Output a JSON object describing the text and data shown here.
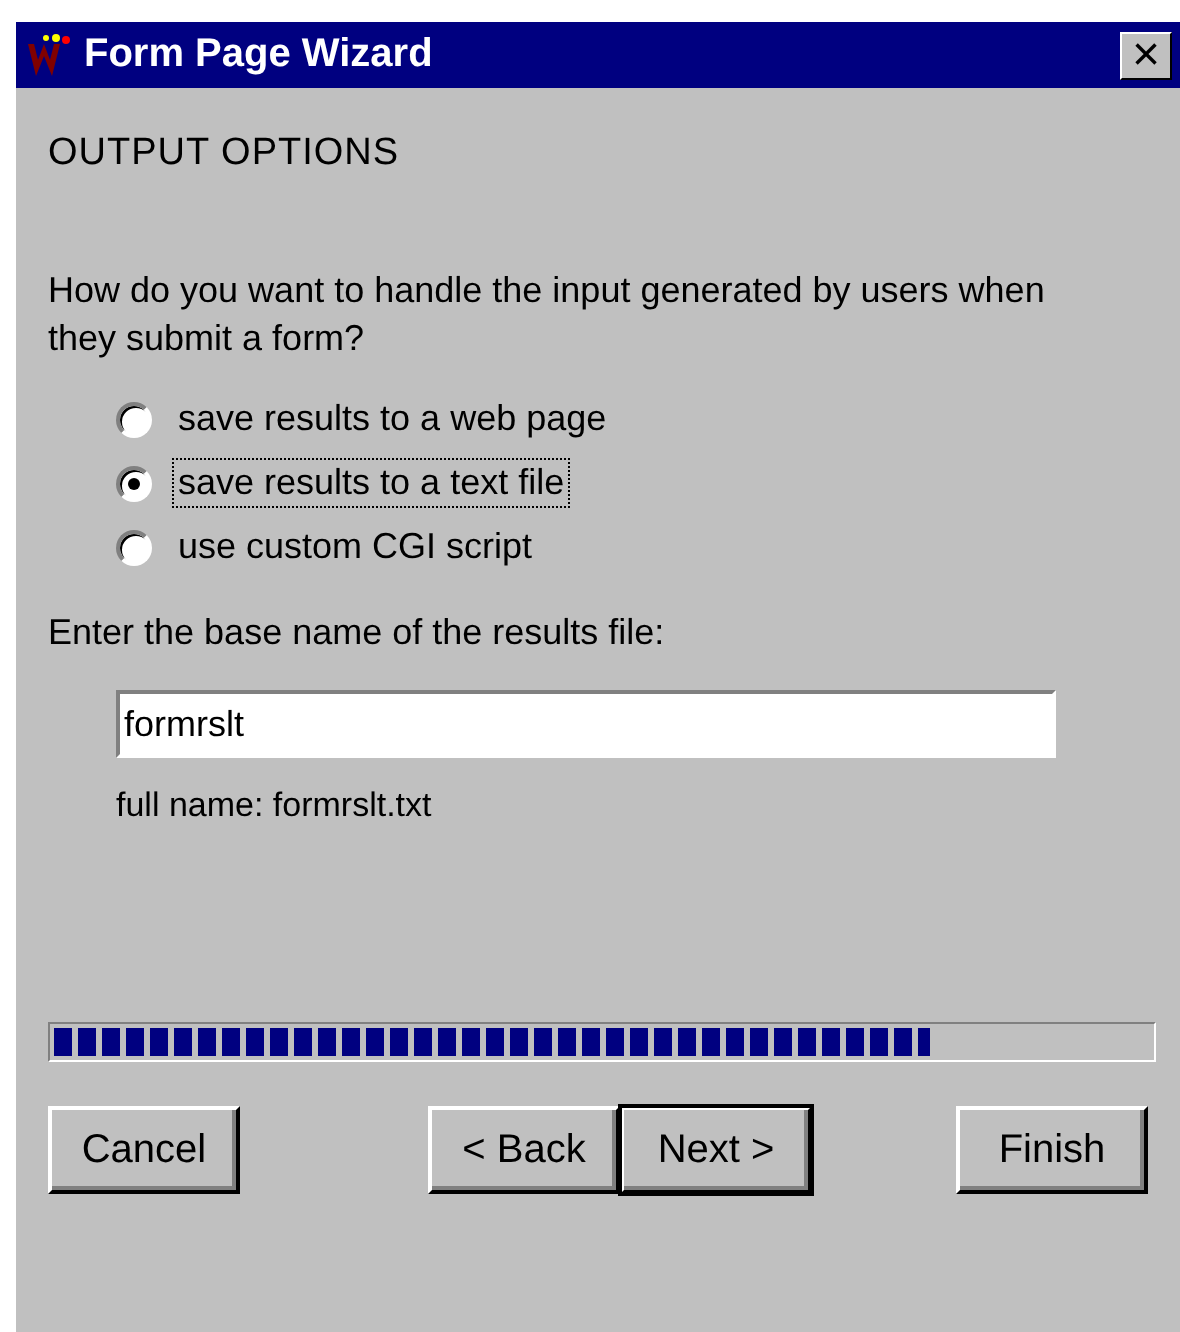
{
  "window": {
    "title": "Form Page Wizard",
    "close": "×"
  },
  "heading": "OUTPUT OPTIONS",
  "question": "How do you want to handle the input generated by users when they submit a form?",
  "options": [
    {
      "label": "save results to a web page",
      "selected": false,
      "focused": false
    },
    {
      "label": "save results to a text file",
      "selected": true,
      "focused": true
    },
    {
      "label": "use custom CGI script",
      "selected": false,
      "focused": false
    }
  ],
  "basename": {
    "label": "Enter the base name of the results file:",
    "value": "formrslt"
  },
  "full_name": "full name: formrslt.txt",
  "progress": {
    "level": 0.8
  },
  "buttons": [
    {
      "label": "Cancel",
      "default": false
    },
    {
      "label": "< Back",
      "default": false
    },
    {
      "label": "Next >",
      "default": true
    },
    {
      "label": "Finish",
      "default": false
    }
  ]
}
